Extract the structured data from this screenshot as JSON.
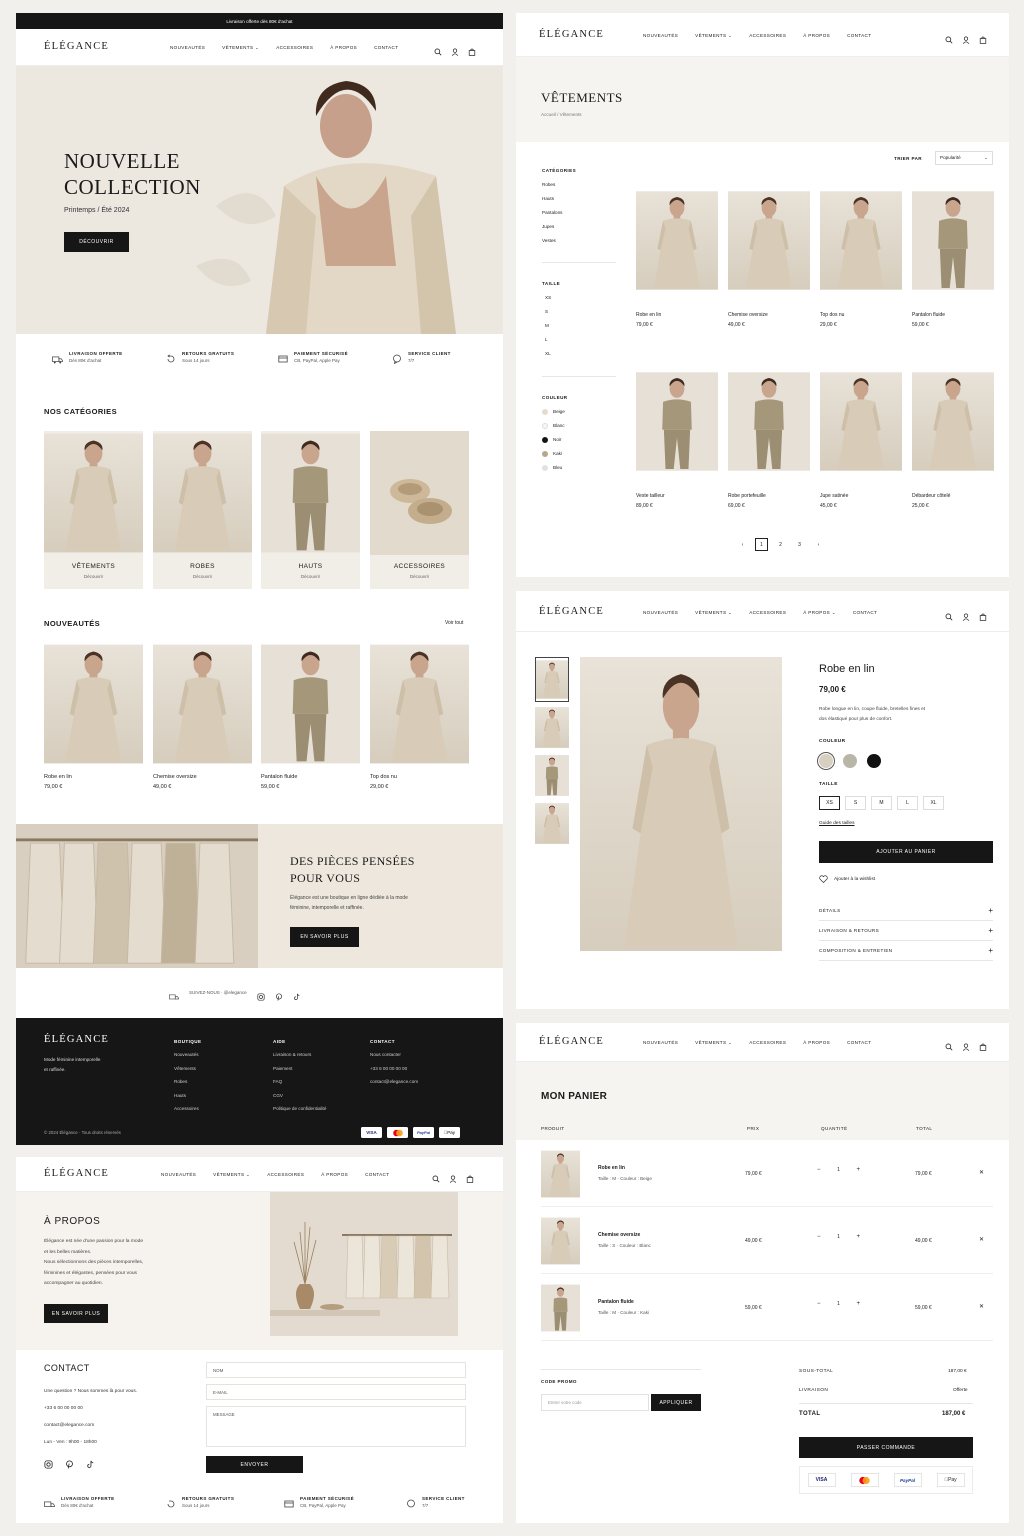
{
  "brand": "ÉLÉGANCE",
  "nav": [
    "NOUVEAUTÉS",
    "VÊTEMENTS ⌄",
    "ACCESSOIRES",
    "À PROPOS",
    "CONTACT"
  ],
  "nav_apropos_dropdown": "À PROPOS ⌄",
  "home": {
    "topbar": "Livraison offerte dès 80€ d'achat",
    "hero_title_1": "NOUVELLE",
    "hero_title_2": "COLLECTION",
    "hero_sub": "Printemps / Été 2024",
    "hero_btn": "DÉCOUVRIR",
    "features": [
      {
        "title": "LIVRAISON OFFERTE",
        "sub": "Dès 80€ d'achat"
      },
      {
        "title": "RETOURS GRATUITS",
        "sub": "Sous 14 jours"
      },
      {
        "title": "PAIEMENT SÉCURISÉ",
        "sub": "CB, PayPal, Apple Pay"
      },
      {
        "title": "SERVICE CLIENT",
        "sub": "7/7"
      }
    ],
    "categories_title": "NOS CATÉGORIES",
    "categories": [
      {
        "name": "VÊTEMENTS",
        "link": "Découvrir"
      },
      {
        "name": "ROBES",
        "link": "Découvrir"
      },
      {
        "name": "HAUTS",
        "link": "Découvrir"
      },
      {
        "name": "ACCESSOIRES",
        "link": "Découvrir"
      }
    ],
    "new_title": "NOUVEAUTÉS",
    "see_all": "Voir tout",
    "new_products": [
      {
        "name": "Robe en lin",
        "price": "79,00 €"
      },
      {
        "name": "Chemise oversize",
        "price": "49,00 €"
      },
      {
        "name": "Pantalon fluide",
        "price": "59,00 €"
      },
      {
        "name": "Top dos nu",
        "price": "29,00 €"
      }
    ],
    "banner_title_1": "DES PIÈCES PENSÉES",
    "banner_title_2": "POUR VOUS",
    "banner_text_1": "Élégance est une boutique en ligne dédiée à la mode",
    "banner_text_2": "féminine, intemporelle et raffinée.",
    "banner_btn": "EN SAVOIR PLUS",
    "social_text": "SUIVEZ-NOUS  ·  @elegance",
    "footer": {
      "tagline_1": "Mode féminine intemporelle",
      "tagline_2": "et raffinée.",
      "cols": [
        {
          "title": "BOUTIQUE",
          "items": [
            "Nouveautés",
            "Vêtements",
            "Robes",
            "Hauts",
            "Accessoires"
          ]
        },
        {
          "title": "AIDE",
          "items": [
            "Livraison & retours",
            "Paiement",
            "FAQ",
            "CGV",
            "Politique de confidentialité"
          ]
        },
        {
          "title": "CONTACT",
          "items": [
            "Nous contacter",
            "+33 6 00 00 00 00",
            "contact@elegance.com"
          ]
        }
      ],
      "copyright": "© 2024 Élégance · Tous droits réservés",
      "payments": [
        "VISA",
        "MC",
        "PayPal",
        "Pay"
      ]
    }
  },
  "about": {
    "title": "À PROPOS",
    "p1": "Élégance est née d'une passion pour la mode",
    "p2": "et les belles matières.",
    "p3": "Nous sélectionnons des pièces intemporelles,",
    "p4": "féminines et élégantes, pensées pour vous",
    "p5": "accompagner au quotidien.",
    "btn": "EN SAVOIR PLUS",
    "contact_title": "CONTACT",
    "contact_q": "Une question ? Nous sommes là pour vous.",
    "phone": "+33 6 00 00 00 00",
    "email": "contact@elegance.com",
    "hours": "Lun - Ven : 9h00 - 18h00",
    "form_nom": "NOM",
    "form_email": "E-MAIL",
    "form_msg": "MESSAGE",
    "form_btn": "ENVOYER"
  },
  "listing": {
    "title": "VÊTEMENTS",
    "breadcrumb": "Accueil  /  Vêtements",
    "sort_label": "TRIER PAR",
    "sort_value": "Popularité",
    "cat_title": "CATÉGORIES",
    "cats": [
      "Robes",
      "Hauts",
      "Pantalons",
      "Jupes",
      "Vestes"
    ],
    "size_title": "TAILLE",
    "sizes": [
      "XS",
      "S",
      "M",
      "L",
      "XL"
    ],
    "color_title": "COULEUR",
    "colors": [
      {
        "name": "Beige",
        "hex": "#e4dccd"
      },
      {
        "name": "Blanc",
        "hex": "#f7f6f3"
      },
      {
        "name": "Noir",
        "hex": "#141414"
      },
      {
        "name": "Kaki",
        "hex": "#b8a88a"
      },
      {
        "name": "Bleu",
        "hex": "#dfe2e4"
      }
    ],
    "products": [
      {
        "name": "Robe en lin",
        "price": "79,00 €"
      },
      {
        "name": "Chemise oversize",
        "price": "49,00 €"
      },
      {
        "name": "Top dos nu",
        "price": "29,00 €"
      },
      {
        "name": "Pantalon fluide",
        "price": "59,00 €"
      },
      {
        "name": "Veste tailleur",
        "price": "89,00 €"
      },
      {
        "name": "Robe portefeuille",
        "price": "69,00 €"
      },
      {
        "name": "Jupe satinée",
        "price": "45,00 €"
      },
      {
        "name": "Débardeur côtelé",
        "price": "25,00 €"
      }
    ],
    "pages": [
      "‹",
      "1",
      "2",
      "3",
      "›"
    ]
  },
  "product": {
    "name": "Robe en lin",
    "price": "79,00 €",
    "desc_1": "Robe longue en lin, coupe fluide, bretelles fines et",
    "desc_2": "dos élastiqué pour plus de confort.",
    "color_label": "COULEUR",
    "swatches": [
      "#d7cfbf",
      "#b9b6a8",
      "#111111"
    ],
    "size_label": "TAILLE",
    "sizes": [
      "XS",
      "S",
      "M",
      "L",
      "XL"
    ],
    "guide": "Guide des tailles",
    "add": "AJOUTER AU PANIER",
    "wishlist": "Ajouter à la wishlist",
    "accordions": [
      "DÉTAILS",
      "LIVRAISON & RETOURS",
      "COMPOSITION & ENTRETIEN"
    ]
  },
  "cart": {
    "title": "MON PANIER",
    "headers": [
      "PRODUIT",
      "PRIX",
      "QUANTITÉ",
      "TOTAL"
    ],
    "items": [
      {
        "name": "Robe en lin",
        "meta": "Taille : M · Couleur : Beige",
        "price": "79,00 €",
        "qty": "1",
        "total": "79,00 €"
      },
      {
        "name": "Chemise oversize",
        "meta": "Taille : S · Couleur : Blanc",
        "price": "49,00 €",
        "qty": "1",
        "total": "49,00 €"
      },
      {
        "name": "Pantalon fluide",
        "meta": "Taille : M · Couleur : Kaki",
        "price": "59,00 €",
        "qty": "1",
        "total": "59,00 €"
      }
    ],
    "promo_label": "CODE PROMO",
    "promo_placeholder": "Entrer votre code",
    "promo_btn": "APPLIQUER",
    "subtotal_label": "SOUS-TOTAL",
    "subtotal": "187,00 €",
    "shipping_label": "LIVRAISON",
    "shipping": "Offerte",
    "total_label": "TOTAL",
    "total": "187,00 €",
    "checkout": "PASSER COMMANDE",
    "payments": [
      "VISA",
      "MC",
      "PayPal",
      "Pay"
    ]
  }
}
